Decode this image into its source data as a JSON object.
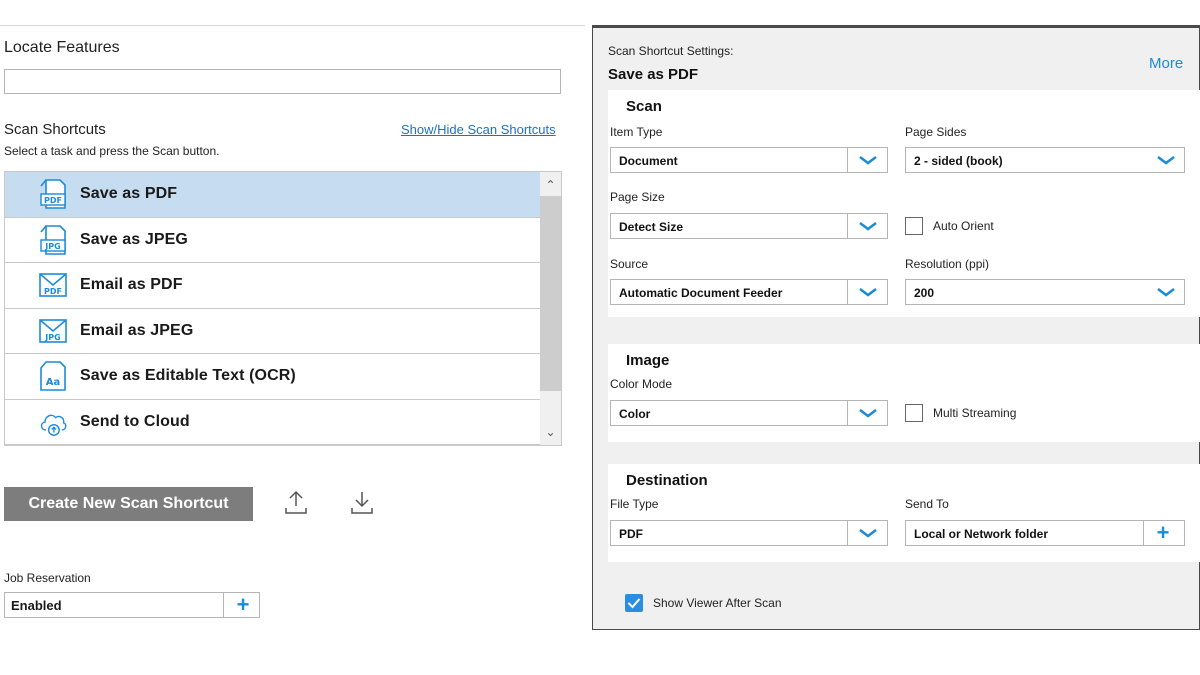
{
  "left": {
    "locate_title": "Locate Features",
    "search_value": "",
    "shortcuts_title": "Scan Shortcuts",
    "shortcuts_subtitle": "Select a task and press the Scan button.",
    "show_hide_link": "Show/Hide Scan Shortcuts",
    "shortcuts": [
      {
        "label": "Save as PDF",
        "icon": "pdf-file-icon",
        "badge": "PDF",
        "selected": true
      },
      {
        "label": "Save as JPEG",
        "icon": "jpeg-file-icon",
        "badge": "JPG"
      },
      {
        "label": "Email as PDF",
        "icon": "email-pdf-icon",
        "badge": "PDF"
      },
      {
        "label": "Email as JPEG",
        "icon": "email-jpeg-icon",
        "badge": "JPG"
      },
      {
        "label": "Save as Editable Text (OCR)",
        "icon": "ocr-text-icon",
        "badge": "Aa"
      },
      {
        "label": "Send to Cloud",
        "icon": "cloud-upload-icon"
      }
    ],
    "create_button": "Create New Scan Shortcut",
    "job_reservation_label": "Job Reservation",
    "job_reservation_value": "Enabled",
    "plus_glyph": "+"
  },
  "right": {
    "subtitle": "Scan Shortcut Settings:",
    "title": "Save as PDF",
    "more_link": "More",
    "scan_section": {
      "heading": "Scan",
      "item_type_label": "Item Type",
      "item_type_value": "Document",
      "page_sides_label": "Page Sides",
      "page_sides_value": "2 - sided (book)",
      "page_size_label": "Page Size",
      "page_size_value": "Detect Size",
      "auto_orient_label": "Auto Orient",
      "source_label": "Source",
      "source_value": "Automatic Document Feeder",
      "resolution_label": "Resolution (ppi)",
      "resolution_value": "200"
    },
    "image_section": {
      "heading": "Image",
      "color_mode_label": "Color Mode",
      "color_mode_value": "Color",
      "multi_streaming_label": "Multi Streaming"
    },
    "destination_section": {
      "heading": "Destination",
      "file_type_label": "File Type",
      "file_type_value": "PDF",
      "send_to_label": "Send To",
      "send_to_value": "Local or Network folder"
    },
    "show_viewer_label": "Show Viewer After Scan",
    "show_viewer_checked": true
  },
  "colors": {
    "accent": "#1a8cd8",
    "selected_row": "#c6dcf0",
    "create_button": "#7d7d7d",
    "panel_bg": "#f0f0f0"
  }
}
